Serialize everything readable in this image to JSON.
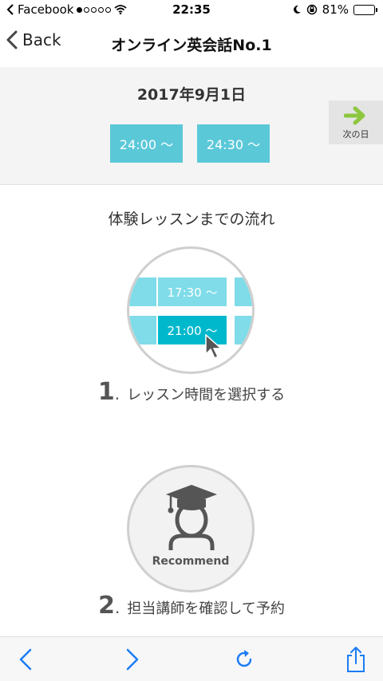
{
  "status_bar": {
    "carrier": "Facebook",
    "time": "22:35",
    "battery_percent": "81%",
    "battery_level": 0.81
  },
  "nav": {
    "back_label": "Back",
    "title": "オンライン英会話No.1"
  },
  "schedule": {
    "date": "2017年9月1日",
    "slots": [
      "24:00 〜",
      "24:30 〜"
    ],
    "next_day_label": "次の日"
  },
  "flow": {
    "title": "体験レッスンまでの流れ",
    "illustration_slots": {
      "top": "17:30 〜",
      "selected": "21:00 〜"
    },
    "steps": [
      {
        "number": "1",
        "text": "レッスン時間を選択する"
      },
      {
        "number": "2",
        "text": "担当講師を確認して予約"
      }
    ],
    "badge_text": "Recommend"
  },
  "toolbar": {
    "icons": [
      "back-arrow-icon",
      "forward-arrow-icon",
      "reload-icon",
      "share-icon"
    ]
  },
  "colors": {
    "accent": "#5bc8d8",
    "ios_blue": "#1a7cf5",
    "next_arrow": "#8dc63f"
  }
}
